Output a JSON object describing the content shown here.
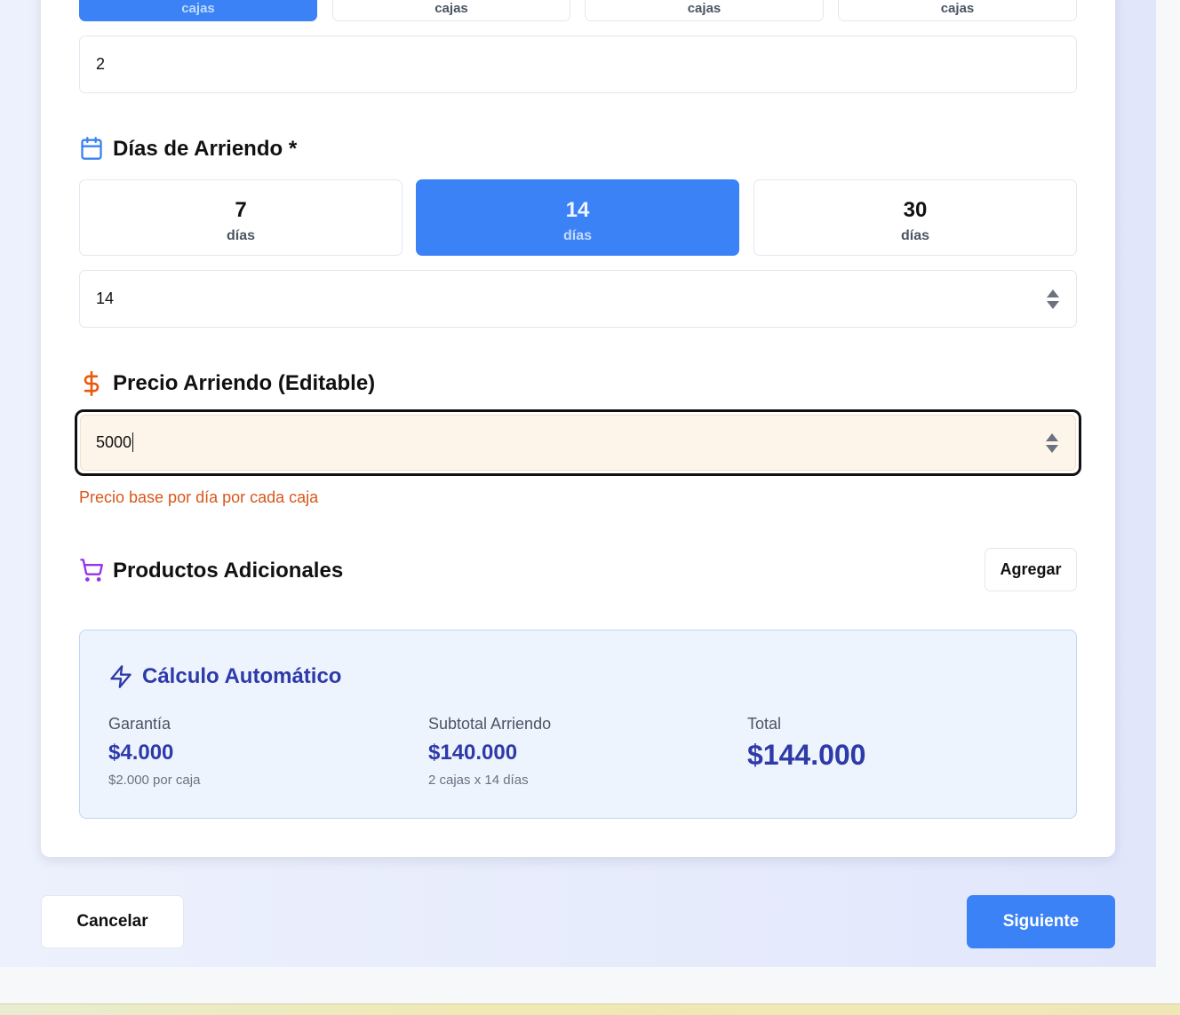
{
  "boxes": {
    "options": [
      {
        "unit": "cajas",
        "active": true
      },
      {
        "unit": "cajas",
        "active": false
      },
      {
        "unit": "cajas",
        "active": false
      },
      {
        "unit": "cajas",
        "active": false
      }
    ],
    "input_value": "2"
  },
  "days": {
    "title": "Días de Arriendo *",
    "options": [
      {
        "value": "7",
        "unit": "días",
        "active": false
      },
      {
        "value": "14",
        "unit": "días",
        "active": true
      },
      {
        "value": "30",
        "unit": "días",
        "active": false
      }
    ],
    "input_value": "14"
  },
  "price": {
    "title": "Precio Arriendo (Editable)",
    "input_value": "5000",
    "help": "Precio base por día por cada caja"
  },
  "products": {
    "title": "Productos Adicionales",
    "add_label": "Agregar"
  },
  "calc": {
    "title": "Cálculo Automático",
    "guarantee": {
      "label": "Garantía",
      "value": "$4.000",
      "note": "$2.000 por caja"
    },
    "subtotal": {
      "label": "Subtotal Arriendo",
      "value": "$140.000",
      "note": "2 cajas x 14 días"
    },
    "total": {
      "label": "Total",
      "value": "$144.000"
    }
  },
  "footer": {
    "cancel_label": "Cancelar",
    "next_label": "Siguiente"
  },
  "colors": {
    "accent": "#3b82f6",
    "calc_text": "#2e3aa8",
    "price_help": "#d9571b",
    "cart_icon": "#9333ea"
  },
  "icons": [
    "calendar-icon",
    "dollar-icon",
    "cart-icon",
    "lightning-icon"
  ]
}
